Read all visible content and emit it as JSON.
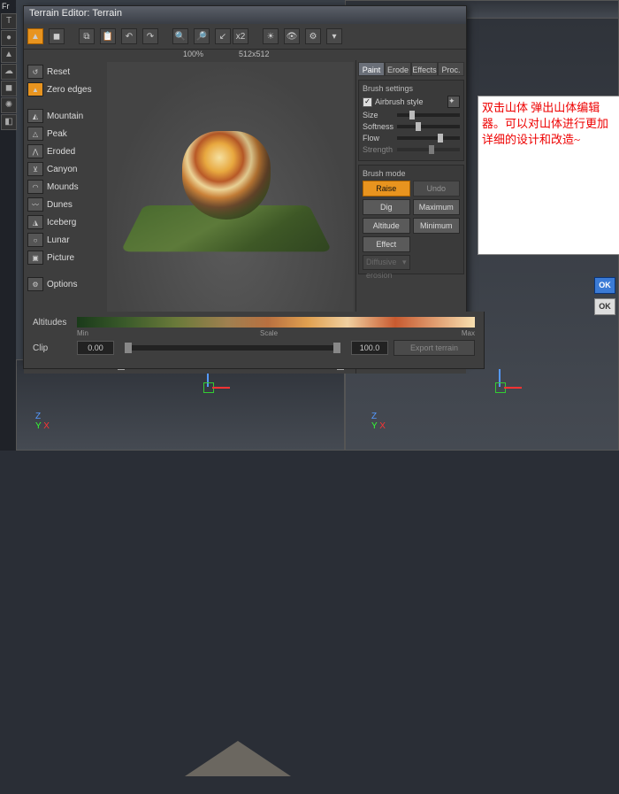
{
  "window": {
    "title": "Terrain Editor: Terrain"
  },
  "toolbar": {
    "zoom_label": "100%",
    "size_label": "512x512",
    "mult": "x2"
  },
  "sidebar": {
    "reset": "Reset",
    "zero": "Zero edges",
    "items": [
      {
        "label": "Mountain"
      },
      {
        "label": "Peak"
      },
      {
        "label": "Eroded"
      },
      {
        "label": "Canyon"
      },
      {
        "label": "Mounds"
      },
      {
        "label": "Dunes"
      },
      {
        "label": "Iceberg"
      },
      {
        "label": "Lunar"
      },
      {
        "label": "Picture"
      }
    ],
    "options": "Options"
  },
  "tabs": [
    "Paint",
    "Erode",
    "Effects",
    "Proc."
  ],
  "brush": {
    "group": "Brush settings",
    "airbrush": "Airbrush style",
    "size": "Size",
    "softness": "Softness",
    "flow": "Flow",
    "strength": "Strength"
  },
  "mode": {
    "group": "Brush mode",
    "raise": "Raise",
    "undo": "Undo",
    "dig": "Dig",
    "max": "Maximum",
    "alt": "Altitude",
    "min": "Minimum",
    "effect": "Effect",
    "combo": "Diffusive erosion"
  },
  "altitude": {
    "label": "Altitudes",
    "min": "Min",
    "scale": "Scale",
    "max": "Max"
  },
  "clip": {
    "label": "Clip",
    "lo": "0.00",
    "hi": "100.0"
  },
  "export": "Export terrain",
  "axes": {
    "x": "X",
    "y": "Y",
    "z": "Z"
  },
  "note_text": "双击山体 弹出山体编辑器。可以对山体进行更加详细的设计和改造~",
  "ok": "OK",
  "front_label": "Fr"
}
